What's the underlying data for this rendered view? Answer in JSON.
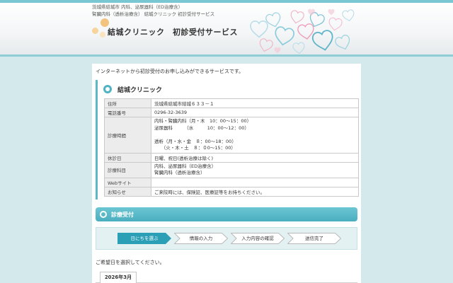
{
  "header": {
    "meta_line1": "茨城県結城市 内科、泌尿器科（ED治療含）",
    "meta_line2": "腎臓内科（透析治療含） 結城クリニック 初診受付サービス",
    "site_title": "結城クリニック　初診受付サービス"
  },
  "intro_text": "インターネットから初診受付のお申し込みができるサービスです。",
  "clinic": {
    "name": "結城クリニック",
    "rows": [
      {
        "label": "住所",
        "value": "茨城県結城市結城６３３－１"
      },
      {
        "label": "電話番号",
        "value": "0296-32-3639"
      },
      {
        "label": "診療時間",
        "value": "内科・腎臓内科（月・木　10：00～15：00）\n泌尿器科　　　（水　　　10：00～12：00）\n\n透析（月・水・金　８：00～18：00）\n　　（火・木・土　８：０0～15：00）"
      },
      {
        "label": "休診日",
        "value": "日曜、祝日(透析治療は除く)"
      },
      {
        "label": "診療科目",
        "value": "内科、泌尿器科（ED治療含）\n腎臓内科（透析治療含）"
      },
      {
        "label": "Webサイト",
        "value": ""
      },
      {
        "label": "お知らせ",
        "value": "ご来院時には、保険証、医療証等をお持ちください。"
      }
    ]
  },
  "reception": {
    "title": "診療受付",
    "steps": [
      "日にちを選ぶ",
      "情報の入力",
      "入力内容の確認",
      "送信完了"
    ],
    "active_step": 0
  },
  "prompt_text": "ご希望日を選択してください。",
  "calendar": {
    "month_tab": "2026年3月"
  },
  "colors": {
    "accent": "#4fb3c2",
    "active_step": "#2a9fb5",
    "background": "#d3e9ec"
  }
}
